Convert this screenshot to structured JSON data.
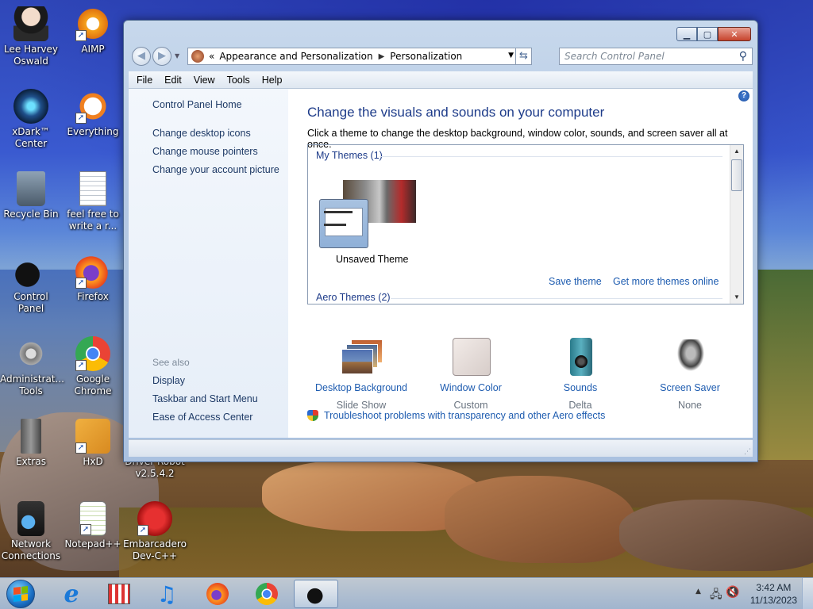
{
  "desktop": {
    "icons": [
      {
        "label": "Lee Harvey Oswald",
        "icon": "anime-character-icon"
      },
      {
        "label": "AIMP",
        "icon": "aimp-icon"
      },
      {
        "label": "xDark™ Center",
        "icon": "xdark-center-icon"
      },
      {
        "label": "Everything",
        "icon": "everything-icon"
      },
      {
        "label": "Recycle Bin",
        "icon": "recycle-bin-icon"
      },
      {
        "label": "feel free to write a r...",
        "icon": "text-document-icon"
      },
      {
        "label": "Control Panel",
        "icon": "control-panel-icon"
      },
      {
        "label": "Firefox",
        "icon": "firefox-icon"
      },
      {
        "label": "Administrat... Tools",
        "icon": "admin-tools-icon"
      },
      {
        "label": "Google Chrome",
        "icon": "chrome-icon"
      },
      {
        "label": "Extras",
        "icon": "extras-icon"
      },
      {
        "label": "HxD",
        "icon": "hxd-icon"
      },
      {
        "label": "Driver Robot v2.5.4.2",
        "icon": "driver-robot-icon"
      },
      {
        "label": "Network Connections",
        "icon": "network-icon"
      },
      {
        "label": "Notepad++",
        "icon": "notepad-plus-plus-icon"
      },
      {
        "label": "Embarcadero Dev-C++",
        "icon": "devcpp-icon"
      }
    ]
  },
  "window": {
    "breadcrumb": [
      "Appearance and Personalization",
      "Personalization"
    ],
    "breadcrumb_prefix": "«",
    "search_placeholder": "Search Control Panel",
    "menu": [
      "File",
      "Edit",
      "View",
      "Tools",
      "Help"
    ],
    "left_pane": {
      "home": "Control Panel Home",
      "links": [
        "Change desktop icons",
        "Change mouse pointers",
        "Change your account picture"
      ],
      "see_also_label": "See also",
      "see_also": [
        "Display",
        "Taskbar and Start Menu",
        "Ease of Access Center"
      ]
    },
    "main": {
      "heading": "Change the visuals and sounds on your computer",
      "subtext": "Click a theme to change the desktop background, window color, sounds, and screen saver all at once.",
      "my_themes": "My Themes (1)",
      "unsaved_theme": "Unsaved Theme",
      "save_theme": "Save theme",
      "get_more": "Get more themes online",
      "aero_themes": "Aero Themes (2)",
      "settings": [
        {
          "label": "Desktop Background",
          "value": "Slide Show",
          "icon": "desktop-background-icon"
        },
        {
          "label": "Window Color",
          "value": "Custom",
          "icon": "window-color-icon"
        },
        {
          "label": "Sounds",
          "value": "Delta",
          "icon": "sounds-icon"
        },
        {
          "label": "Screen Saver",
          "value": "None",
          "icon": "screen-saver-icon"
        }
      ],
      "troubleshoot": "Troubleshoot problems with transparency and other Aero effects"
    }
  },
  "taskbar": {
    "pinned": [
      "internet-explorer-icon",
      "store-icon",
      "music-icon",
      "firefox-icon",
      "chrome-icon",
      "control-panel-icon"
    ],
    "time": "3:42 AM",
    "date": "11/13/2023"
  }
}
